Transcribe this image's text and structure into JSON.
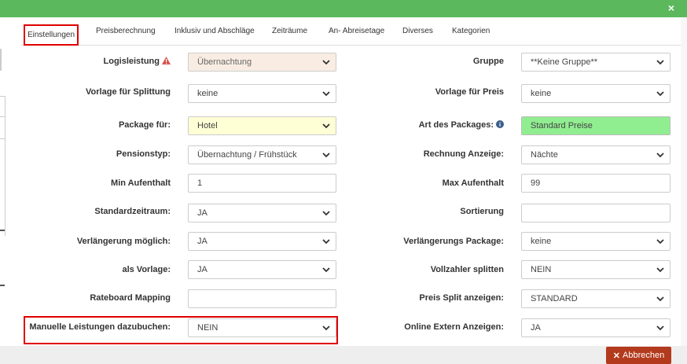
{
  "dialog": {
    "close_symbol": "×",
    "colors": {
      "header": "#5cb85c",
      "active_highlight": "#e00000",
      "cancel_button": "#b33a1d",
      "disabled_bg": "#f9ede3",
      "highlight_yellow": "#ffffd6",
      "highlight_green": "#90ee90"
    }
  },
  "tabs": [
    {
      "label": "Einstellungen"
    },
    {
      "label": "Preisberechnung"
    },
    {
      "label": "Inklusiv und Abschläge"
    },
    {
      "label": "Zeiträume"
    },
    {
      "label": "An- Abreisetage"
    },
    {
      "label": "Diverses"
    },
    {
      "label": "Kategorien"
    }
  ],
  "left": {
    "logisleistung": {
      "label": "Logisleistung",
      "value": "Übernachtung",
      "icon": "warning-icon"
    },
    "vorlage_splittung": {
      "label": "Vorlage für Splittung",
      "value": "keine"
    },
    "package_fuer": {
      "label": "Package für:",
      "value": "Hotel"
    },
    "pensionstyp": {
      "label": "Pensionstyp:",
      "value": "Übernachtung / Frühstück"
    },
    "min_aufenthalt": {
      "label": "Min Aufenthalt",
      "value": "1"
    },
    "standardzeitraum": {
      "label": "Standardzeitraum:",
      "value": "JA"
    },
    "verlaengerung": {
      "label": "Verlängerung möglich:",
      "value": "JA"
    },
    "als_vorlage": {
      "label": "als Vorlage:",
      "value": "JA"
    },
    "rateboard": {
      "label": "Rateboard Mapping",
      "value": ""
    },
    "manuelle": {
      "label": "Manuelle Leistungen dazubuchen:",
      "value": "NEIN"
    }
  },
  "right": {
    "gruppe": {
      "label": "Gruppe",
      "value": "**Keine Gruppe**"
    },
    "vorlage_preis": {
      "label": "Vorlage für Preis",
      "value": "keine"
    },
    "art_package": {
      "label": "Art des Packages:",
      "value": "Standard Preise",
      "icon": "info-icon"
    },
    "rechnung_anzeige": {
      "label": "Rechnung Anzeige:",
      "value": "Nächte"
    },
    "max_aufenthalt": {
      "label": "Max Aufenthalt",
      "value": "99"
    },
    "sortierung": {
      "label": "Sortierung",
      "value": ""
    },
    "verlaengerungs_package": {
      "label": "Verlängerungs Package:",
      "value": "keine"
    },
    "vollzahler": {
      "label": "Vollzahler splitten",
      "value": "NEIN"
    },
    "preis_split": {
      "label": "Preis Split anzeigen:",
      "value": "STANDARD"
    },
    "online_extern": {
      "label": "Online Extern Anzeigen:",
      "value": "JA"
    }
  },
  "footer": {
    "cancel_label": "Abbrechen",
    "cancel_icon": "close-icon"
  }
}
